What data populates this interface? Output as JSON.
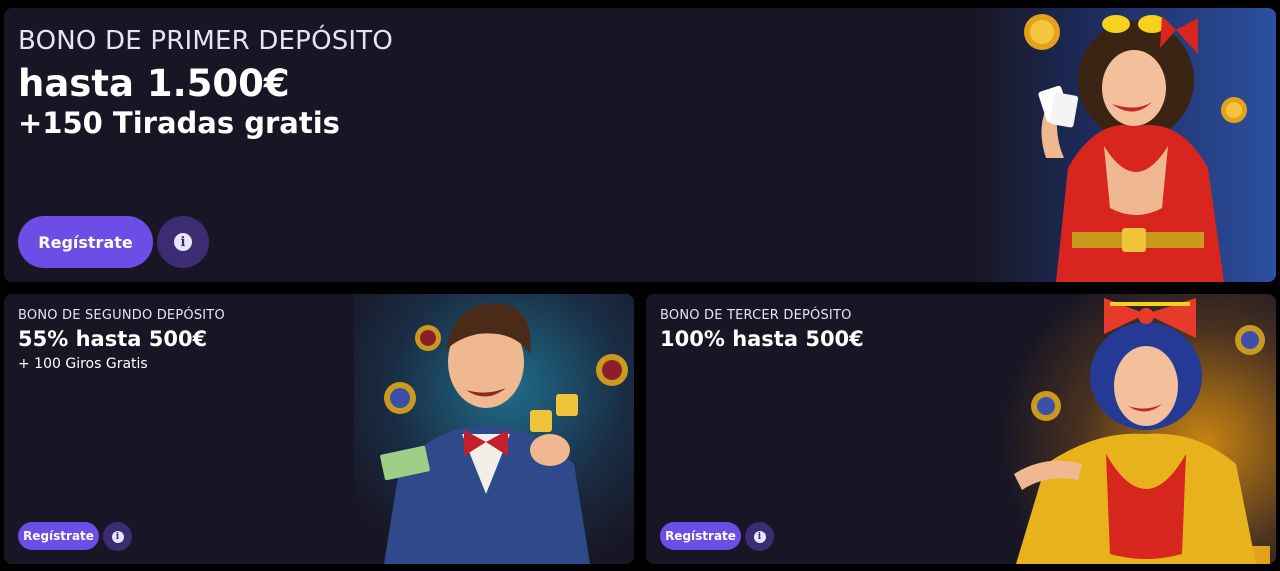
{
  "colors": {
    "page_background": "#000000",
    "card_background": "#181624",
    "primary_button": "#6c4de6",
    "info_button": "#3c2c72",
    "text_primary": "#ffffff",
    "text_eyebrow": "#e6e3f2"
  },
  "main_promo": {
    "eyebrow": "BONO DE PRIMER DEPÓSITO",
    "headline": "hasta 1.500€",
    "sub": "+150 Tiradas gratis",
    "register_label": "Regístrate",
    "info_glyph": "i",
    "art_icon": "woman-with-cards-icon"
  },
  "second_promo": {
    "eyebrow": "BONO DE SEGUNDO DEPÓSITO",
    "headline": "55% hasta 500€",
    "sub": "+ 100 Giros Gratis",
    "register_label": "Regístrate",
    "info_glyph": "i",
    "art_icon": "man-with-dice-icon"
  },
  "third_promo": {
    "eyebrow": "BONO DE TERCER DEPÓSITO",
    "headline": "100% hasta 500€",
    "register_label": "Regístrate",
    "info_glyph": "i",
    "art_icon": "woman-with-bow-icon"
  }
}
